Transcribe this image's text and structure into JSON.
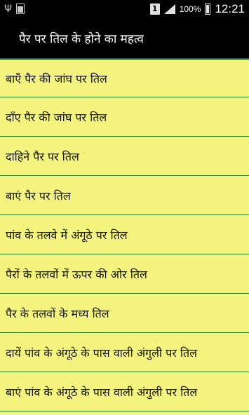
{
  "status_bar": {
    "sim": "1",
    "small_battery_label": "100",
    "battery_percent": "100%",
    "time": "12:21"
  },
  "title": "पैर पर तिल के होने का महत्व",
  "items": [
    "बाएँ पैर की जांघ पर तिल",
    "दाँए पैर की जांघ पर तिल",
    "दाहिने पैर पर तिल",
    "बाएं पैर पर तिल",
    "पांव के तलवे में अंगूठे पर तिल",
    "पैरों के तलवों में ऊपर की ओर तिल",
    "पैर के तलवों के मध्य तिल",
    "दायें पांव के अंगूठे के पास वाली अंगुली पर तिल",
    "बाएं पांव के अंगूठे के पास वाली अंगुली पर तिल"
  ]
}
